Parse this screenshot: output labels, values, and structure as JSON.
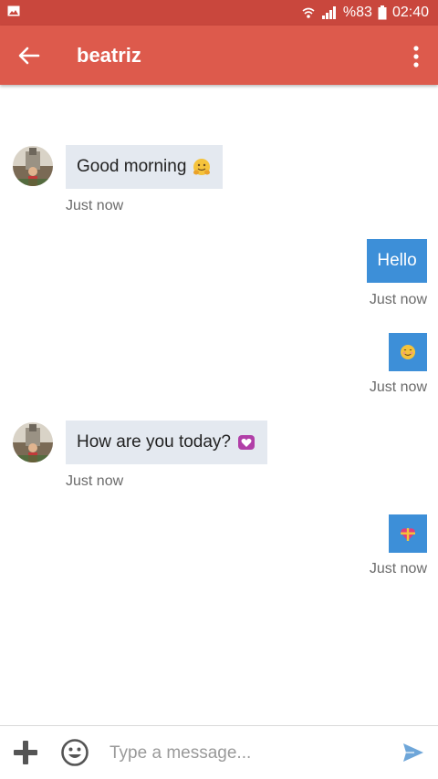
{
  "status_bar": {
    "battery": "%83",
    "time": "02:40"
  },
  "header": {
    "title": "beatriz"
  },
  "messages": [
    {
      "direction": "in",
      "text": "Good morning",
      "emoji": "hugging-face",
      "time": "Just now"
    },
    {
      "direction": "out",
      "text": "Hello",
      "time": "Just now"
    },
    {
      "direction": "out",
      "text": "",
      "emoji": "smiling-face",
      "time": "Just now"
    },
    {
      "direction": "in",
      "text": "How are you today?",
      "emoji": "heart-box",
      "time": "Just now"
    },
    {
      "direction": "out",
      "text": "",
      "emoji": "heart-gift",
      "time": "Just now"
    }
  ],
  "composer": {
    "placeholder": "Type a message..."
  },
  "colors": {
    "status_bar": "#c9473d",
    "app_bar": "#dd5a4c",
    "outgoing_bubble": "#3d8fd8",
    "incoming_bubble": "#e4e9f0"
  }
}
